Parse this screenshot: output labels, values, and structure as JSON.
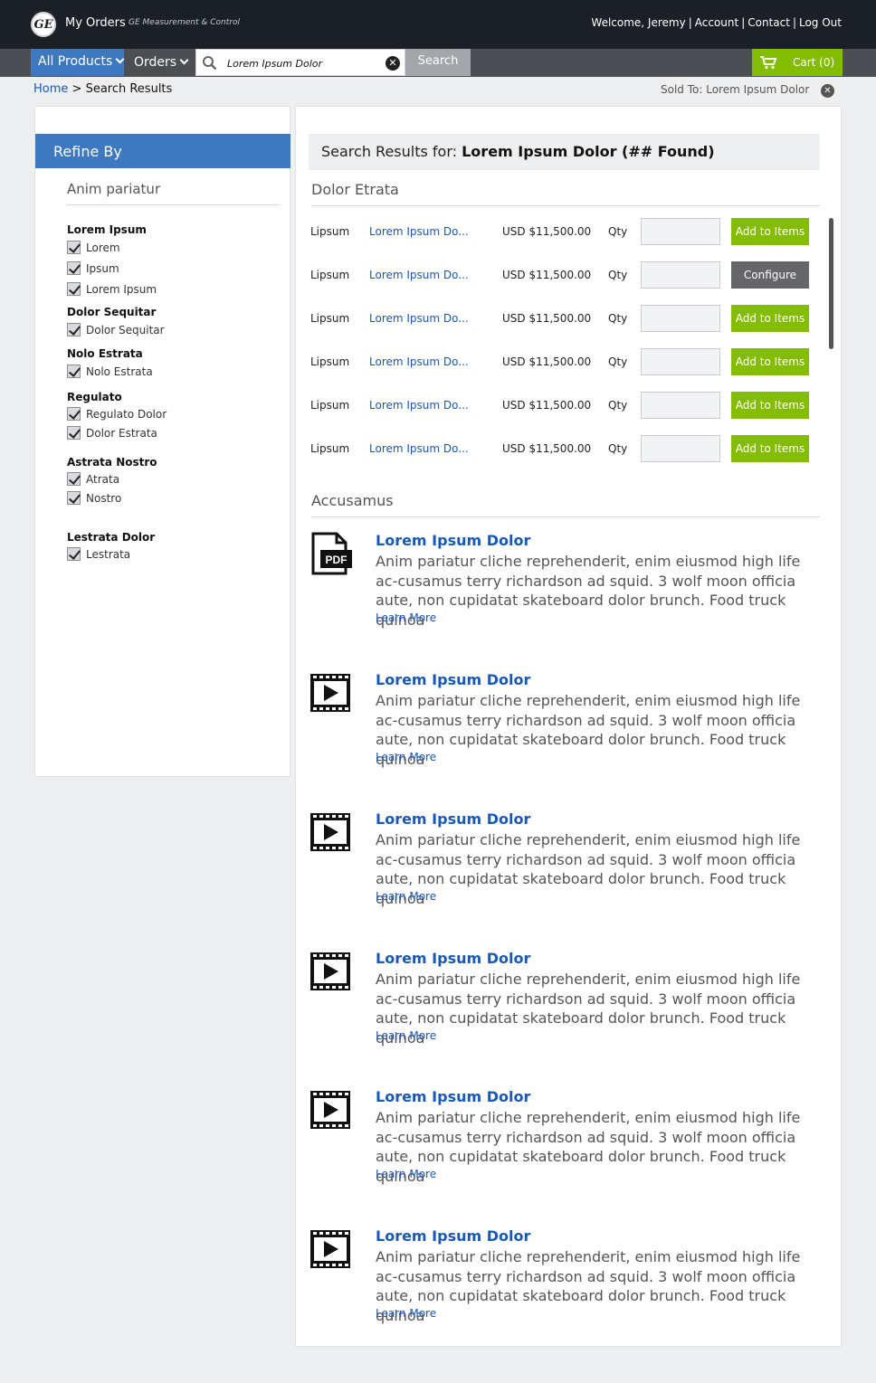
{
  "header": {
    "logo_text": "GE",
    "app_name": "My Orders",
    "sub_name": "GE Measurement & Control",
    "welcome": "Welcome, Jeremy",
    "links": [
      "Account",
      "Contact",
      "Log Out"
    ]
  },
  "nav": {
    "all_products": "All Products",
    "orders": "Orders",
    "search_value": "Lorem Ipsum Dolor",
    "search_button": "Search",
    "cart": "Cart (0)"
  },
  "breadcrumb": {
    "home": "Home",
    "current": "Search Results"
  },
  "sold_to": "Sold To: Lorem Ipsum Dolor",
  "sidebar": {
    "title": "Refine By",
    "heading": "Anim pariatur",
    "groups": [
      {
        "name": "Lorem Ipsum",
        "options": [
          "Lorem",
          "Ipsum",
          "Lorem Ipsum"
        ]
      },
      {
        "name": "Dolor Sequitar",
        "options": [
          "Dolor Sequitar"
        ]
      },
      {
        "name": "Nolo Estrata",
        "options": [
          "Nolo Estrata"
        ]
      },
      {
        "name": "Regulato",
        "options": [
          "Regulato Dolor",
          "Dolor Estrata"
        ]
      },
      {
        "name": "Astrata Nostro",
        "options": [
          "Atrata",
          "Nostro"
        ]
      },
      {
        "name": "Lestrata Dolor",
        "options": [
          "Lestrata"
        ]
      }
    ]
  },
  "results": {
    "label": "Search Results for: ",
    "query": "Lorem Ipsum Dolor (## Found)",
    "products_heading": "Dolor Etrata",
    "qty_label": "Qty",
    "products": [
      {
        "name": "Lipsum",
        "link": "Lorem Ipsum Do...",
        "price": "USD $11,500.00",
        "action": "Add to Items",
        "kind": "green"
      },
      {
        "name": "Lipsum",
        "link": "Lorem Ipsum Do...",
        "price": "USD $11,500.00",
        "action": "Configure",
        "kind": "gray"
      },
      {
        "name": "Lipsum",
        "link": "Lorem Ipsum Do...",
        "price": "USD $11,500.00",
        "action": "Add to Items",
        "kind": "green"
      },
      {
        "name": "Lipsum",
        "link": "Lorem Ipsum Do...",
        "price": "USD $11,500.00",
        "action": "Add to Items",
        "kind": "green"
      },
      {
        "name": "Lipsum",
        "link": "Lorem Ipsum Do...",
        "price": "USD $11,500.00",
        "action": "Add to Items",
        "kind": "green"
      },
      {
        "name": "Lipsum",
        "link": "Lorem Ipsum Do...",
        "price": "USD $11,500.00",
        "action": "Add to Items",
        "kind": "green"
      }
    ],
    "docs_heading": "Accusamus",
    "docs": [
      {
        "icon": "pdf-icon",
        "icon_text": "PDF",
        "title": "Lorem Ipsum Dolor",
        "desc": "Anim pariatur cliche reprehenderit, enim eiusmod high life ac-cusamus terry richardson ad squid. 3 wolf moon officia aute, non cupidatat skateboard dolor brunch. Food truck quinoa",
        "more": "Learn More"
      },
      {
        "icon": "video-icon",
        "title": "Lorem Ipsum Dolor",
        "desc": "Anim pariatur cliche reprehenderit, enim eiusmod high life ac-cusamus terry richardson ad squid. 3 wolf moon officia aute, non cupidatat skateboard dolor brunch. Food truck quinoa",
        "more": "Learn More"
      },
      {
        "icon": "video-icon",
        "title": "Lorem Ipsum Dolor",
        "desc": "Anim pariatur cliche reprehenderit, enim eiusmod high life ac-cusamus terry richardson ad squid. 3 wolf moon officia aute, non cupidatat skateboard dolor brunch. Food truck quinoa",
        "more": "Learn More"
      },
      {
        "icon": "video-icon",
        "title": "Lorem Ipsum Dolor",
        "desc": "Anim pariatur cliche reprehenderit, enim eiusmod high life ac-cusamus terry richardson ad squid. 3 wolf moon officia aute, non cupidatat skateboard dolor brunch. Food truck quinoa",
        "more": "Learn More"
      },
      {
        "icon": "video-icon",
        "title": "Lorem Ipsum Dolor",
        "desc": "Anim pariatur cliche reprehenderit, enim eiusmod high life ac-cusamus terry richardson ad squid. 3 wolf moon officia aute, non cupidatat skateboard dolor brunch. Food truck quinoa",
        "more": "Learn More"
      },
      {
        "icon": "video-icon",
        "title": "Lorem Ipsum Dolor",
        "desc": "Anim pariatur cliche reprehenderit, enim eiusmod high life ac-cusamus terry richardson ad squid. 3 wolf moon officia aute, non cupidatat skateboard dolor brunch. Food truck quinoa",
        "more": "Learn More"
      }
    ]
  },
  "colors": {
    "accent_blue": "#3d78c0",
    "link_blue": "#1a58b5",
    "green": "#84bd00",
    "topbar": "#1b1f26"
  }
}
